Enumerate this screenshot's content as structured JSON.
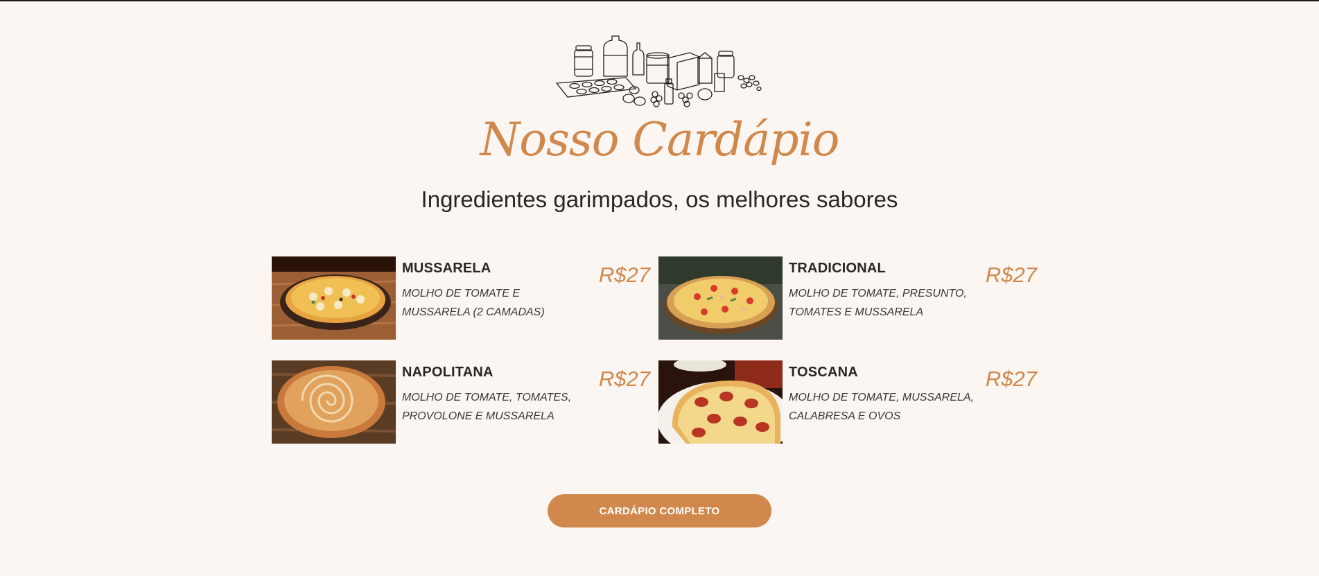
{
  "section": {
    "title": "Nosso Cardápio",
    "subtitle": "Ingredientes garimpados, os melhores sabores"
  },
  "menu": {
    "items": [
      {
        "name": "MUSSARELA",
        "description": "MOLHO DE TOMATE E MUSSARELA (2 CAMADAS)",
        "price": "R$27"
      },
      {
        "name": "TRADICIONAL",
        "description": "MOLHO DE TOMATE, PRESUNTO, TOMATES E MUSSARELA",
        "price": "R$27"
      },
      {
        "name": "NAPOLITANA",
        "description": "MOLHO DE TOMATE, TOMATES, PROVOLONE E MUSSARELA",
        "price": "R$27"
      },
      {
        "name": "TOSCANA",
        "description": "MOLHO DE TOMATE, MUSSARELA, CALABRESA E OVOS",
        "price": "R$27"
      }
    ]
  },
  "cta": {
    "label": "CARDÁPIO COMPLETO"
  },
  "colors": {
    "background": "#fbf6f2",
    "accent": "#d0884c",
    "text": "#2a2622"
  },
  "icons": {
    "hero": "kitchen-ingredients-illustration",
    "photos": [
      "pizza-mussarela-photo",
      "pizza-tradicional-photo",
      "pizza-napolitana-photo",
      "pizza-toscana-photo"
    ]
  }
}
